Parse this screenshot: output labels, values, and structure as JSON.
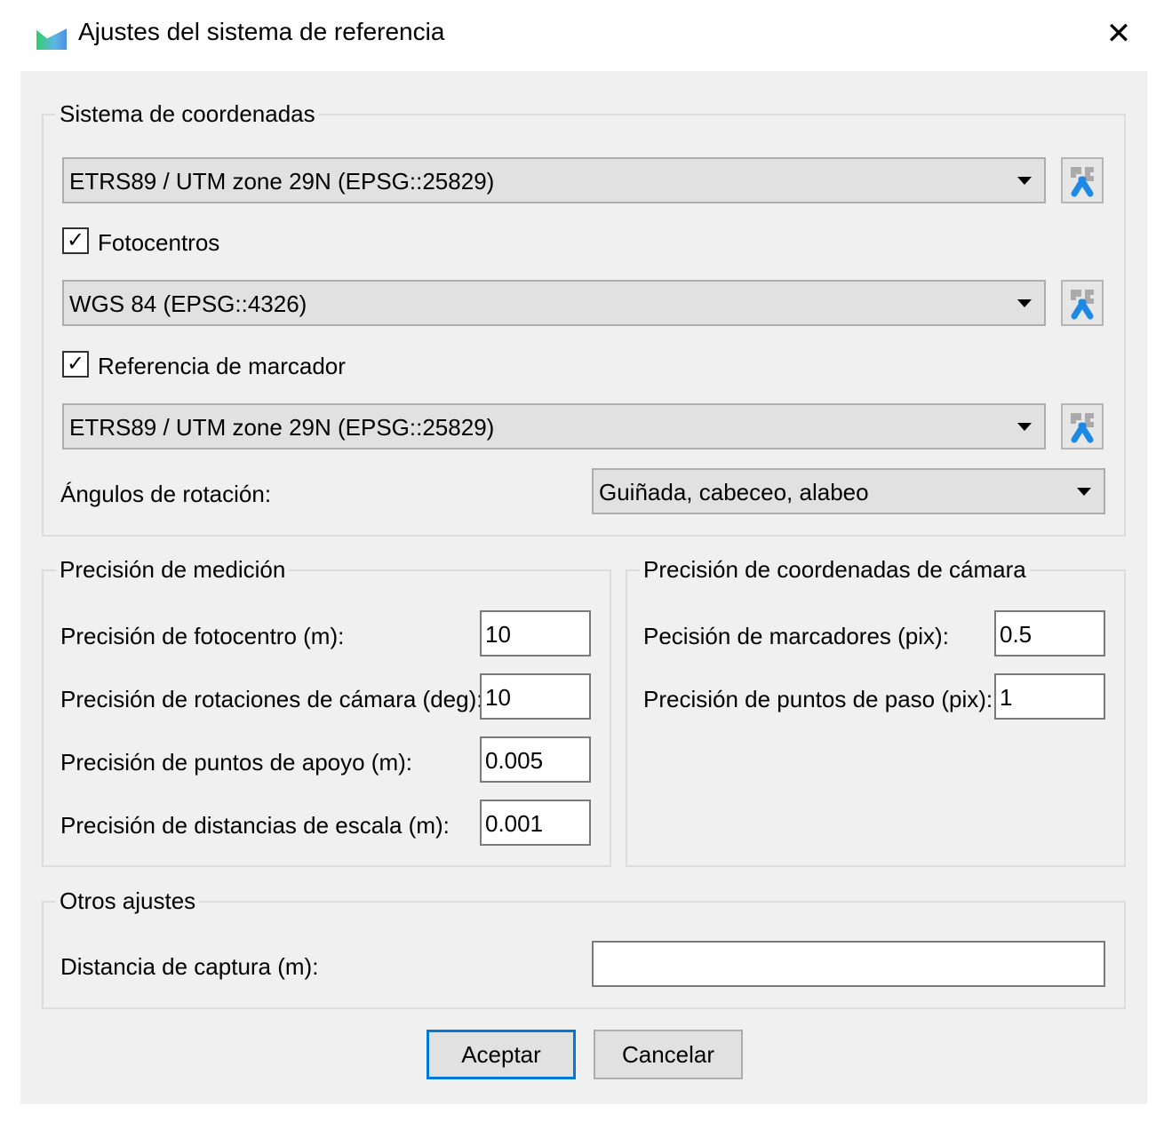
{
  "window": {
    "title": "Ajustes del sistema de referencia",
    "icon": "app-logo-icon",
    "close_icon": "close-icon"
  },
  "coord_system": {
    "title": "Sistema de coordenadas",
    "main_crs": "ETRS89 / UTM zone 29N (EPSG::25829)",
    "fotocentros": {
      "label": "Fotocentros",
      "checked": true,
      "crs": "WGS 84 (EPSG::4326)"
    },
    "marker_ref": {
      "label": "Referencia de marcador",
      "checked": true,
      "crs": "ETRS89 / UTM zone 29N (EPSG::25829)"
    },
    "rotation": {
      "label": "Ángulos de rotación:",
      "value": "Guiñada, cabeceo, alabeo"
    },
    "check_mark": "✓"
  },
  "measurement": {
    "title": "Precisión de medición",
    "fields": [
      {
        "label": "Precisión de fotocentro (m):",
        "value": "10"
      },
      {
        "label": "Precisión de rotaciones de cámara (deg):",
        "value": "10"
      },
      {
        "label": "Precisión de puntos de apoyo (m):",
        "value": "0.005"
      },
      {
        "label": "Precisión de distancias de escala (m):",
        "value": "0.001"
      }
    ]
  },
  "camera": {
    "title": "Precisión de coordenadas de cámara",
    "fields": [
      {
        "label": "Pecisión de marcadores (pix):",
        "value": "0.5"
      },
      {
        "label": "Precisión de puntos de paso (pix):",
        "value": "1"
      }
    ]
  },
  "other": {
    "title": "Otros ajustes",
    "capture_label": "Distancia de captura (m):",
    "capture_value": ""
  },
  "buttons": {
    "ok": "Aceptar",
    "cancel": "Cancelar"
  },
  "colors": {
    "accent": "#0078d7",
    "panel": "#f0f0f0"
  }
}
